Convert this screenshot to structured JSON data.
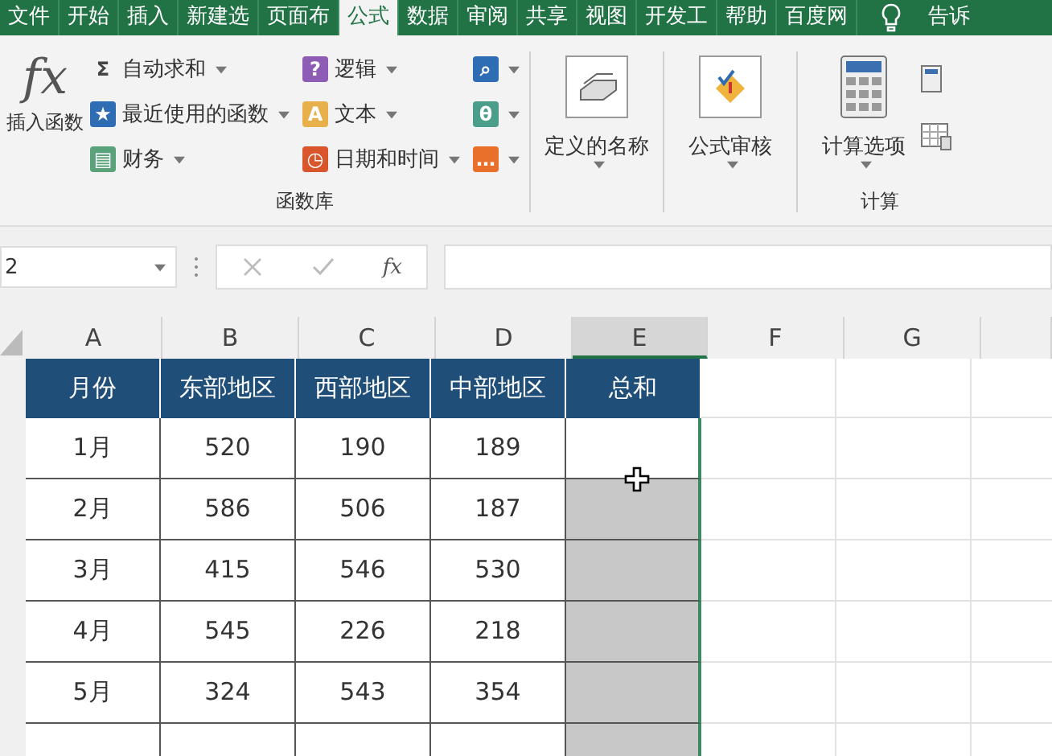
{
  "tabs": [
    {
      "label": "文件",
      "selected": false
    },
    {
      "label": "开始",
      "selected": false
    },
    {
      "label": "插入",
      "selected": false
    },
    {
      "label": "新建选",
      "selected": false
    },
    {
      "label": "页面布",
      "selected": false
    },
    {
      "label": "公式",
      "selected": true
    },
    {
      "label": "数据",
      "selected": false
    },
    {
      "label": "审阅",
      "selected": false
    },
    {
      "label": "共享",
      "selected": false
    },
    {
      "label": "视图",
      "selected": false
    },
    {
      "label": "开发工",
      "selected": false
    },
    {
      "label": "帮助",
      "selected": false
    },
    {
      "label": "百度网",
      "selected": false
    }
  ],
  "tell_me": "告诉",
  "ribbon": {
    "insert_function": {
      "symbol": "fx",
      "label": "插入函数"
    },
    "function_columns": [
      [
        {
          "glyph": "Σ",
          "label": "自动求和",
          "color": "#444444"
        },
        {
          "glyph": "★",
          "label": "最近使用的函数",
          "color": "#2e6db4"
        },
        {
          "glyph": "▤",
          "label": "财务",
          "color": "#5aa37a"
        }
      ],
      [
        {
          "glyph": "?",
          "label": "逻辑",
          "color": "#8e5bb5"
        },
        {
          "glyph": "A",
          "label": "文本",
          "color": "#e8b04a"
        },
        {
          "glyph": "◷",
          "label": "日期和时间",
          "color": "#d9552b"
        }
      ],
      [
        {
          "glyph": "⌕",
          "color": "#2e6db4"
        },
        {
          "glyph": "θ",
          "color": "#4a9e8a"
        },
        {
          "glyph": "…",
          "color": "#e8702a"
        }
      ]
    ],
    "function_group": "函数库",
    "defined_names": "定义的名称",
    "formula_audit": "公式审核",
    "calc_options": "计算选项",
    "calc_group": "计算"
  },
  "formula_bar": {
    "name_box": "2",
    "fx": "fx"
  },
  "columns": [
    {
      "label": "A",
      "selected": false
    },
    {
      "label": "B",
      "selected": false
    },
    {
      "label": "C",
      "selected": false
    },
    {
      "label": "D",
      "selected": false
    },
    {
      "label": "E",
      "selected": true
    },
    {
      "label": "F",
      "selected": false
    },
    {
      "label": "G",
      "selected": false
    }
  ],
  "table": {
    "headers": [
      "月份",
      "东部地区",
      "西部地区",
      "中部地区",
      "总和"
    ],
    "rows": [
      {
        "cells": [
          "1月",
          "520",
          "190",
          "189"
        ],
        "selected": false
      },
      {
        "cells": [
          "2月",
          "586",
          "506",
          "187"
        ],
        "selected": true
      },
      {
        "cells": [
          "3月",
          "415",
          "546",
          "530"
        ],
        "selected": true
      },
      {
        "cells": [
          "4月",
          "545",
          "226",
          "218"
        ],
        "selected": true
      },
      {
        "cells": [
          "5月",
          "324",
          "543",
          "354"
        ],
        "selected": true
      }
    ]
  }
}
